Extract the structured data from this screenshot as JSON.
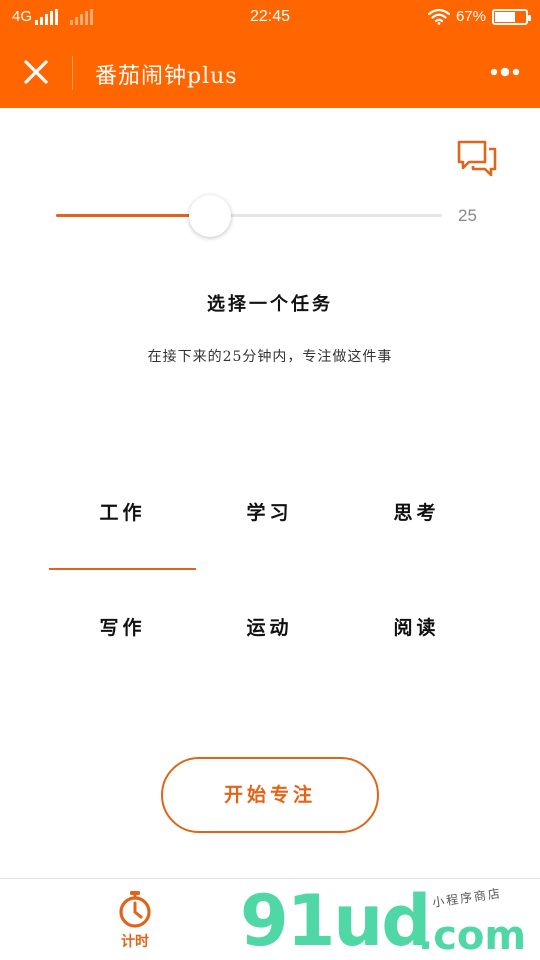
{
  "status_bar": {
    "network": "4G",
    "time": "22:45",
    "battery_text": "67%",
    "battery_level": 0.67
  },
  "nav": {
    "title": "番茄闹钟plus",
    "close_icon": "close-icon",
    "more_icon": "more-dots-icon"
  },
  "feedback_icon": "chat-bubbles-icon",
  "slider": {
    "value": 25,
    "value_label": "25",
    "fill_fraction": 0.4
  },
  "heading": "选择一个任务",
  "subheading": "在接下来的25分钟内，专注做这件事",
  "tasks": [
    {
      "label": "工作",
      "selected": true
    },
    {
      "label": "学习",
      "selected": false
    },
    {
      "label": "思考",
      "selected": false
    },
    {
      "label": "写作",
      "selected": false
    },
    {
      "label": "运动",
      "selected": false
    },
    {
      "label": "阅读",
      "selected": false
    }
  ],
  "start_button": "开始专注",
  "tab_bar": {
    "items": [
      {
        "label": "计时",
        "icon": "stopwatch-icon",
        "active": true
      }
    ]
  },
  "watermark": {
    "logo": "91ud",
    "suffix": ".com",
    "caption": "小程序商店"
  },
  "colors": {
    "brand": "#ff6600",
    "accent": "#e0651a",
    "watermark": "#4fd8a6"
  }
}
